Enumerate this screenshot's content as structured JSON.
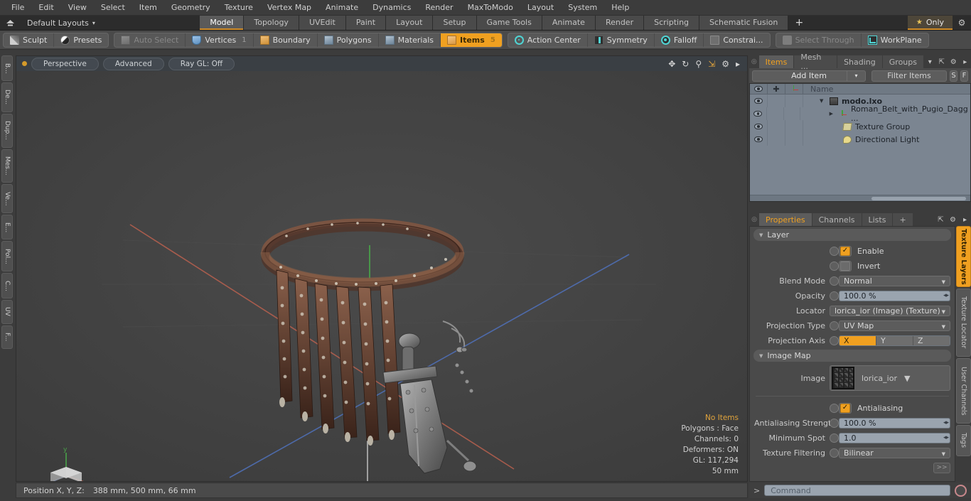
{
  "menubar": {
    "items": [
      "File",
      "Edit",
      "View",
      "Select",
      "Item",
      "Geometry",
      "Texture",
      "Vertex Map",
      "Animate",
      "Dynamics",
      "Render",
      "MaxToModo",
      "Layout",
      "System",
      "Help"
    ]
  },
  "layoutbar": {
    "home_icon": "home-icon",
    "default_layouts": "Default Layouts",
    "caret": "▾",
    "tabs": [
      {
        "label": "Model",
        "active": true
      },
      {
        "label": "Topology",
        "active": false
      },
      {
        "label": "UVEdit",
        "active": false
      },
      {
        "label": "Paint",
        "active": false
      },
      {
        "label": "Layout",
        "active": false
      },
      {
        "label": "Setup",
        "active": false
      },
      {
        "label": "Game Tools",
        "active": false
      },
      {
        "label": "Animate",
        "active": false
      },
      {
        "label": "Render",
        "active": false
      },
      {
        "label": "Scripting",
        "active": false
      },
      {
        "label": "Schematic Fusion",
        "active": false
      }
    ],
    "plus": "+",
    "only_label": "Only",
    "star": "★",
    "gear": "⚙"
  },
  "modebar": {
    "group1": [
      {
        "label": "Sculpt",
        "icon": "brush-icon",
        "state": "normal"
      },
      {
        "label": "Presets",
        "icon": "sphere-icon",
        "state": "normal"
      }
    ],
    "group2": [
      {
        "label": "Auto Select",
        "icon": "cube-icon",
        "state": "disabled",
        "num": ""
      },
      {
        "label": "Vertices",
        "icon": "shield-icon",
        "state": "normal",
        "num": "1"
      },
      {
        "label": "Boundary",
        "icon": "arrow-cube-icon",
        "state": "normal",
        "num": ""
      },
      {
        "label": "Polygons",
        "icon": "cube-icon",
        "state": "normal",
        "num": ""
      },
      {
        "label": "Materials",
        "icon": "cube-icon",
        "state": "normal",
        "num": ""
      },
      {
        "label": "Items",
        "icon": "cube-orange-icon",
        "state": "selected",
        "num": "5"
      }
    ],
    "group3": [
      {
        "label": "Action Center",
        "icon": "target-icon",
        "state": "normal"
      },
      {
        "label": "Symmetry",
        "icon": "symmetry-icon",
        "state": "normal"
      },
      {
        "label": "Falloff",
        "icon": "falloff-icon",
        "state": "normal"
      },
      {
        "label": "Constrai...",
        "icon": "constraint-icon",
        "state": "normal"
      }
    ],
    "group4": [
      {
        "label": "Select Through",
        "icon": "select-through-icon",
        "state": "disabled"
      },
      {
        "label": "WorkPlane",
        "icon": "workplane-icon",
        "state": "normal"
      }
    ]
  },
  "left_tabs": [
    "B...",
    "De...",
    "Dup...",
    "Mes...",
    "Ve...",
    "E...",
    "Pol...",
    "C...",
    "UV",
    "F..."
  ],
  "viewport": {
    "buttons": [
      "Perspective",
      "Advanced",
      "Ray GL: Off"
    ],
    "icons": [
      "move-icon",
      "rotate-icon",
      "zoom-icon",
      "fit-icon",
      "gear-icon",
      "play-icon"
    ],
    "stats": [
      {
        "text": "No Items",
        "highlight": true
      },
      {
        "text": "Polygons : Face",
        "highlight": false
      },
      {
        "text": "Channels: 0",
        "highlight": false
      },
      {
        "text": "Deformers: ON",
        "highlight": false
      },
      {
        "text": "GL: 117,294",
        "highlight": false
      },
      {
        "text": "50 mm",
        "highlight": false
      }
    ]
  },
  "items_panel": {
    "tabs": [
      {
        "label": "Items",
        "active": true
      },
      {
        "label": "Mesh ...",
        "active": false
      },
      {
        "label": "Shading",
        "active": false
      },
      {
        "label": "Groups",
        "active": false
      }
    ],
    "tab_caret": "▾",
    "tab_icons": [
      "expand-icon",
      "gear-icon",
      "chevron-right-icon"
    ],
    "add_item": "Add Item",
    "add_item_caret": "▾",
    "filter_items": "Filter Items",
    "s_button": "S",
    "f_button": "F",
    "column_header_name": "Name",
    "rows": [
      {
        "name": "modo.lxo",
        "icon": "scene-icon",
        "indent": 0,
        "bold": true,
        "tri": "▼"
      },
      {
        "name": "Roman_Belt_with_Pugio_Dagg ...",
        "icon": "mesh-icon",
        "indent": 1,
        "bold": false,
        "tri": "▶"
      },
      {
        "name": "Texture Group",
        "icon": "folder-icon",
        "indent": 1,
        "bold": false,
        "tri": ""
      },
      {
        "name": "Directional Light",
        "icon": "light-icon",
        "indent": 1,
        "bold": false,
        "tri": ""
      }
    ]
  },
  "properties_panel": {
    "tabs": [
      {
        "label": "Properties",
        "active": true
      },
      {
        "label": "Channels",
        "active": false
      },
      {
        "label": "Lists",
        "active": false
      },
      {
        "label": "+",
        "active": false
      }
    ],
    "tab_icons": [
      "expand-icon",
      "gear-icon",
      "chevron-right-icon"
    ],
    "sections": {
      "layer": "Layer",
      "image_map": "Image Map"
    },
    "layer": {
      "enable_label": "Enable",
      "enable_checked": true,
      "invert_label": "Invert",
      "invert_checked": false,
      "blend_mode_label": "Blend Mode",
      "blend_mode_value": "Normal",
      "opacity_label": "Opacity",
      "opacity_value": "100.0 %",
      "locator_label": "Locator",
      "locator_value": "lorica_ior (Image) (Texture)",
      "projection_type_label": "Projection Type",
      "projection_type_value": "UV Map",
      "projection_axis_label": "Projection Axis",
      "projection_axis_options": [
        "X",
        "Y",
        "Z"
      ],
      "projection_axis_selected": "X"
    },
    "image_map": {
      "image_label": "Image",
      "image_value": "lorica_ior",
      "antialiasing_label": "Antialiasing",
      "antialiasing_checked": true,
      "aa_strength_label": "Antialiasing Strength",
      "aa_strength_value": "100.0 %",
      "min_spot_label": "Minimum Spot",
      "min_spot_value": "1.0",
      "tex_filter_label": "Texture Filtering",
      "tex_filter_value": "Bilinear",
      "more_button": ">>"
    },
    "side_tabs": [
      "Texture Layers",
      "Texture Locator",
      "User Channels",
      "Tags"
    ],
    "side_tab_active": "Texture Layers"
  },
  "statusbar": {
    "position_label": "Position X, Y, Z:",
    "position_value": "388 mm, 500 mm, 66 mm"
  },
  "commandbar": {
    "prompt": ">",
    "placeholder": "Command",
    "record_icon": "record-icon"
  },
  "colors": {
    "accent": "#f0a020",
    "panel": "#4a4a4a",
    "list_bg": "#7b8591",
    "viewport_bg": "#434343"
  }
}
